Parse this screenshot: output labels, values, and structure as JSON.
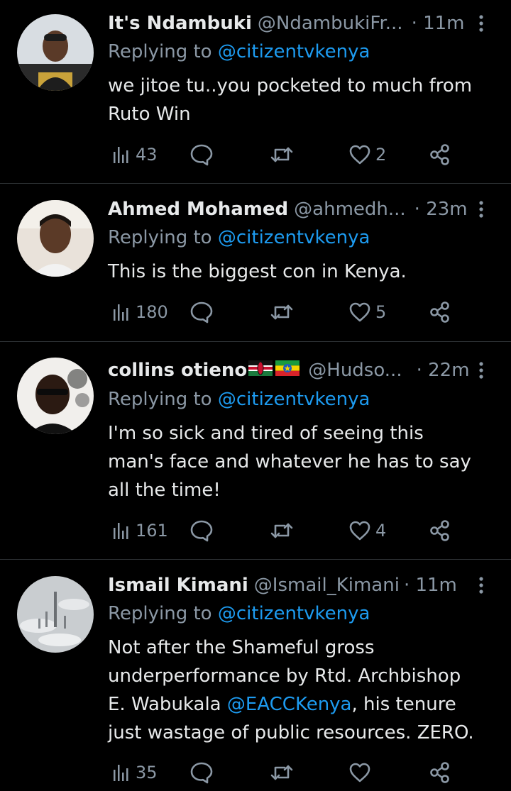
{
  "tweets": [
    {
      "name": "It's Ndambuki",
      "handle": "@NdambukiFr...",
      "time": "· 11m",
      "replying_label": "Replying to",
      "replying_to": "@citizentvkenya",
      "text_lines": [
        "we jitoe tu..you pocketed to much from",
        "Ruto Win"
      ],
      "views": "43",
      "replies": "",
      "retweets": "",
      "likes": "2"
    },
    {
      "name": "Ahmed Mohamed",
      "handle": "@ahmedh...",
      "time": "· 23m",
      "replying_label": "Replying to",
      "replying_to": "@citizentvkenya",
      "text_lines": [
        "This is the biggest con in Kenya."
      ],
      "views": "180",
      "replies": "",
      "retweets": "",
      "likes": "5"
    },
    {
      "name": "collins otieno",
      "name_flags": [
        "kenya-flag",
        "ethiopia-flag"
      ],
      "handle": "@Hudso...",
      "time": "· 22m",
      "replying_label": "Replying to",
      "replying_to": "@citizentvkenya",
      "text_lines": [
        "I'm so sick and tired of seeing this",
        "man's face and whatever he has to say",
        "all the time!"
      ],
      "views": "161",
      "replies": "",
      "retweets": "",
      "likes": "4"
    },
    {
      "name": "Ismail Kimani",
      "handle": "@Ismail_Kimani",
      "time": "· 11m",
      "replying_label": "Replying to",
      "replying_to": "@citizentvkenya",
      "text_line1": "Not after the Shameful gross",
      "text_line2": "underperformance by Rtd. Archbishop",
      "text_line3_pre": "E. Wabukala ",
      "text_line3_mention": "@EACCKenya",
      "text_line3_post": ", his tenure",
      "text_line4": "just wastage of public resources. ZERO.",
      "views": "35",
      "replies": "",
      "retweets": "",
      "likes": ""
    }
  ],
  "icons": [
    "views-icon",
    "reply-icon",
    "retweet-icon",
    "like-icon",
    "share-icon",
    "more-icon"
  ],
  "colors": {
    "background": "#000000",
    "text": "#e7e9ea",
    "secondary": "#8b98a5",
    "accent": "#1d9bf0",
    "divider": "#2f3336"
  }
}
